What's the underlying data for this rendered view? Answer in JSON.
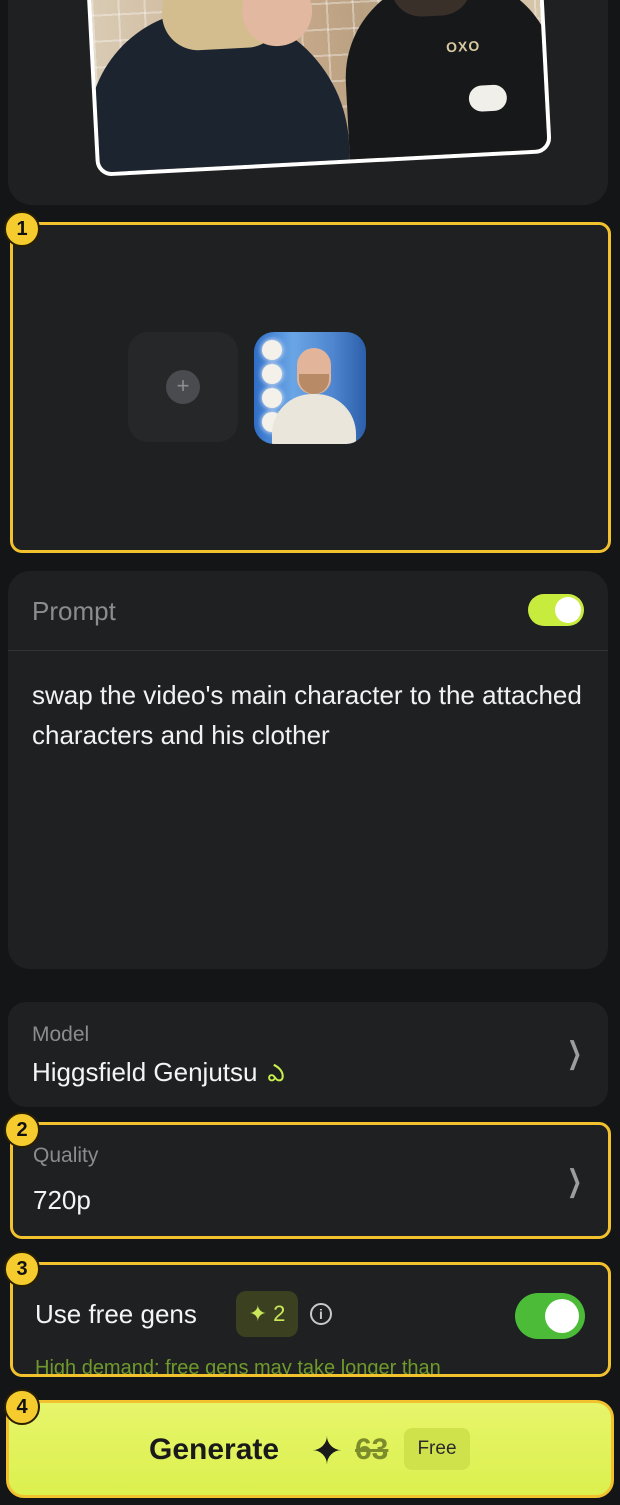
{
  "video": {
    "jersey_logo": "OXO"
  },
  "badges": {
    "b1": "1",
    "b2": "2",
    "b3": "3",
    "b4": "4"
  },
  "reference": {
    "add_symbol": "+"
  },
  "prompt": {
    "title": "Prompt",
    "enabled": true,
    "text": "swap the video's main character to the attached characters and his clother"
  },
  "model": {
    "label": "Model",
    "value": "Higgsfield Genjutsu",
    "icon": "genjutsu-icon",
    "icon_glyph": "ఎ"
  },
  "quality": {
    "label": "Quality",
    "value": "720p"
  },
  "free_gens": {
    "label": "Use free gens",
    "count_glyph": "✦",
    "count": "2",
    "info_glyph": "i",
    "enabled": true,
    "notice": "High demand: free gens may take longer than"
  },
  "generate": {
    "label": "Generate",
    "spark_glyph": "✦",
    "cost": "63",
    "free_label": "Free"
  },
  "colors": {
    "accent": "#dcf04e",
    "toggle_on": "#4bbb38",
    "annotation": "#f2c12e",
    "card_bg": "#1f2022"
  }
}
